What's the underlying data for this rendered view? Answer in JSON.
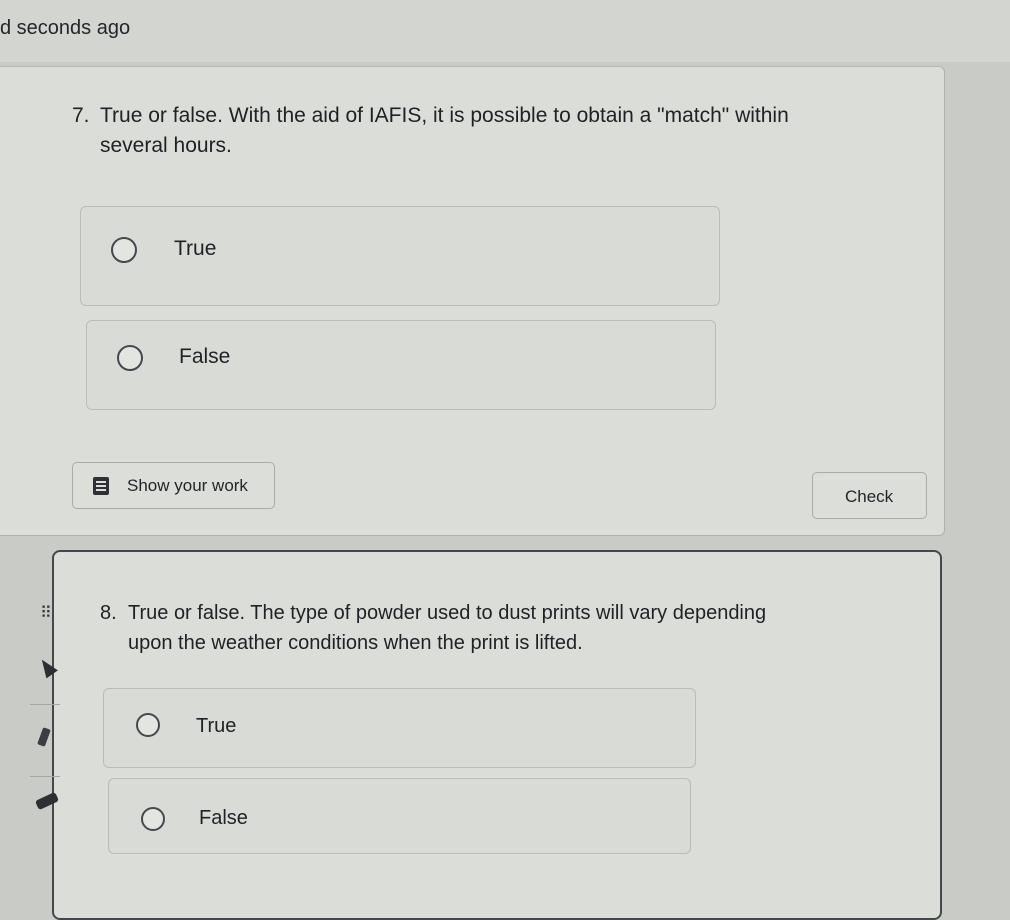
{
  "header": {
    "saved_status": "d seconds ago"
  },
  "questions": [
    {
      "number": "7.",
      "line1": "True or false. With the aid of IAFIS, it is possible to obtain a \"match\" within",
      "line2": "several hours.",
      "options": [
        {
          "label": "True"
        },
        {
          "label": "False"
        }
      ],
      "show_work_label": "Show your work",
      "check_label": "Check"
    },
    {
      "number": "8.",
      "line1": "True or false. The type of powder used to dust prints will vary depending",
      "line2": "upon the weather conditions when the print is lifted.",
      "options": [
        {
          "label": "True"
        },
        {
          "label": "False"
        }
      ]
    }
  ],
  "icons": {
    "show_work": "document-icon",
    "drag": "drag-handle-icon",
    "tools": [
      "cursor-icon",
      "highlighter-icon",
      "eraser-icon"
    ]
  },
  "drag_handle_glyph": "⠿"
}
